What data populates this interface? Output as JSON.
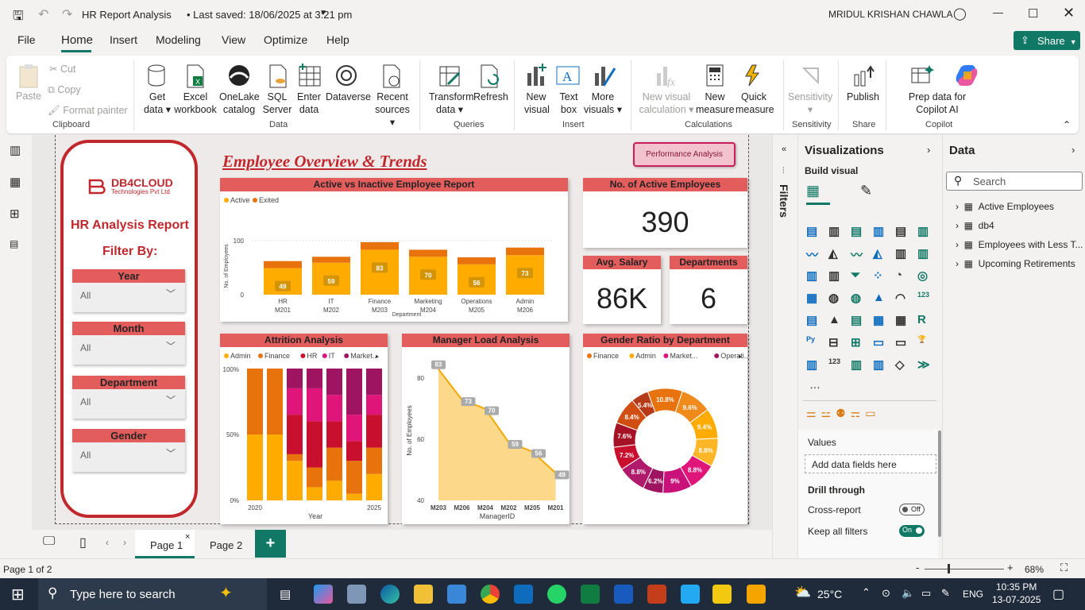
{
  "titlebar": {
    "doc_title": "HR Report Analysis",
    "saved": "• Last saved: 18/06/2025 at 3:21 pm",
    "user": "MRIDUL KRISHAN CHAWLA"
  },
  "menu": {
    "file": "File",
    "home": "Home",
    "insert": "Insert",
    "modeling": "Modeling",
    "view": "View",
    "optimize": "Optimize",
    "help": "Help",
    "share": "Share"
  },
  "ribbon": {
    "paste": "Paste",
    "cut": "Cut",
    "copy": "Copy",
    "format_painter": "Format painter",
    "clipboard": "Clipboard",
    "get_data": "Get data",
    "excel": "Excel workbook",
    "onelake": "OneLake catalog",
    "sql": "SQL Server",
    "enter": "Enter data",
    "dataverse": "Dataverse",
    "recent": "Recent sources",
    "data": "Data",
    "transform": "Transform data",
    "refresh": "Refresh",
    "queries": "Queries",
    "new_visual": "New visual",
    "text_box": "Text box",
    "more_visuals": "More visuals",
    "insert": "Insert",
    "new_calc": "New visual calculation",
    "new_measure": "New measure",
    "quick_measure": "Quick measure",
    "calculations": "Calculations",
    "sensitivity_btn": "Sensitivity",
    "sensitivity": "Sensitivity",
    "publish": "Publish",
    "share_grp": "Share",
    "prep": "Prep data for Copilot AI",
    "copilot": "Copilot"
  },
  "report": {
    "title": "Employee Overview & Trends",
    "perf_button": "Performance Analysis",
    "logo_name": "DB4CLOUD",
    "logo_sub": "Technologies Pvt Ltd",
    "hr_title": "HR Analysis Report",
    "filter_by": "Filter By:",
    "slicers": [
      {
        "label": "Year",
        "value": "All"
      },
      {
        "label": "Month",
        "value": "All"
      },
      {
        "label": "Department",
        "value": "All"
      },
      {
        "label": "Gender",
        "value": "All"
      }
    ],
    "kpi_active_label": "No. of Active Employees",
    "kpi_active": "390",
    "kpi_salary_label": "Avg. Salary",
    "kpi_salary": "86K",
    "kpi_dept_label": "Departments",
    "kpi_dept": "6",
    "chart1_title": "Active vs Inactive Employee Report",
    "chart2_title": "Attrition Analysis",
    "chart3_title": "Manager Load Analysis",
    "chart4_title": "Gender Ratio by Department"
  },
  "chart_data": [
    {
      "type": "bar",
      "title": "Active vs Inactive Employee Report",
      "series": [
        {
          "name": "Active",
          "values": [
            49,
            59,
            83,
            70,
            56,
            73
          ]
        },
        {
          "name": "Exited",
          "values": [
            13,
            11,
            14,
            13,
            13,
            14
          ]
        }
      ],
      "categories": [
        "HR M201",
        "IT M202",
        "Finance M203",
        "Marketing M204",
        "Operations M205",
        "Admin M206"
      ],
      "xlabel": "Department",
      "ylabel": "No. of Employees",
      "yticks": [
        "0",
        "100"
      ],
      "ylim": [
        0,
        110
      ],
      "colors": [
        "#ffab00",
        "#e8730c"
      ]
    },
    {
      "type": "bar",
      "title": "Attrition Analysis",
      "legend": [
        "Admin",
        "Finance",
        "HR",
        "IT",
        "Market..."
      ],
      "xlabel": "Year",
      "yticks": [
        "0%",
        "50%",
        "100%"
      ],
      "xticks": [
        "2020",
        "2025"
      ],
      "stacks": [
        [
          50,
          50,
          0,
          0,
          0
        ],
        [
          50,
          50,
          0,
          0,
          0
        ],
        [
          30,
          5,
          30,
          20,
          15
        ],
        [
          10,
          15,
          35,
          25,
          15
        ],
        [
          15,
          25,
          20,
          20,
          20
        ],
        [
          5,
          25,
          15,
          20,
          35
        ],
        [
          20,
          20,
          25,
          15,
          20
        ]
      ],
      "colors": [
        "#ffab00",
        "#e8730c",
        "#c8102e",
        "#e0157a",
        "#9e1460"
      ]
    },
    {
      "type": "area",
      "title": "Manager Load Analysis",
      "categories": [
        "M203",
        "M206",
        "M204",
        "M202",
        "M205",
        "M201"
      ],
      "values": [
        83,
        73,
        70,
        59,
        56,
        49
      ],
      "xlabel": "ManagerID",
      "ylabel": "No. of Employees",
      "yticks": [
        "40",
        "60",
        "80"
      ],
      "ylim": [
        40,
        85
      ]
    },
    {
      "type": "pie",
      "title": "Gender Ratio by Department",
      "legend": [
        "Finance",
        "Admin",
        "Market...",
        "Operati..."
      ],
      "values": [
        10.8,
        9.6,
        9.4,
        8.8,
        8.8,
        9,
        6.2,
        8.8,
        7.2,
        7.6,
        8.4,
        5.4
      ],
      "labels": [
        "10.8%",
        "9.6%",
        "9.4%",
        "8.8%",
        "8.8%",
        "9%",
        "6.2%",
        "8.8%",
        "7.2%",
        "7.6%",
        "8.4%",
        "5.4%"
      ],
      "colors": [
        "#e8730c",
        "#e8730c",
        "#ffab00",
        "#ffab00",
        "#e0157a",
        "#e0157a",
        "#9e1460",
        "#9e1460",
        "#c8102e",
        "#c8102e",
        "#e8730c",
        "#d2521b"
      ]
    }
  ],
  "panes": {
    "filters": "Filters",
    "viz_title": "Visualizations",
    "build_visual": "Build visual",
    "values": "Values",
    "add_fields": "Add data fields here",
    "drill": "Drill through",
    "cross_report": "Cross-report",
    "cross_off": "Off",
    "keep_filters": "Keep all filters",
    "keep_on": "On",
    "data_title": "Data",
    "search": "Search",
    "tables": [
      "Active Employees",
      "db4",
      "Employees with Less T...",
      "Upcoming Retirements"
    ]
  },
  "pages": {
    "page1": "Page 1",
    "page2": "Page 2",
    "status": "Page 1 of 2",
    "zoom": "68%"
  },
  "taskbar": {
    "search": "Type here to search",
    "temp": "25°C",
    "lang": "ENG",
    "time": "10:35 PM",
    "date": "13-07-2025"
  }
}
